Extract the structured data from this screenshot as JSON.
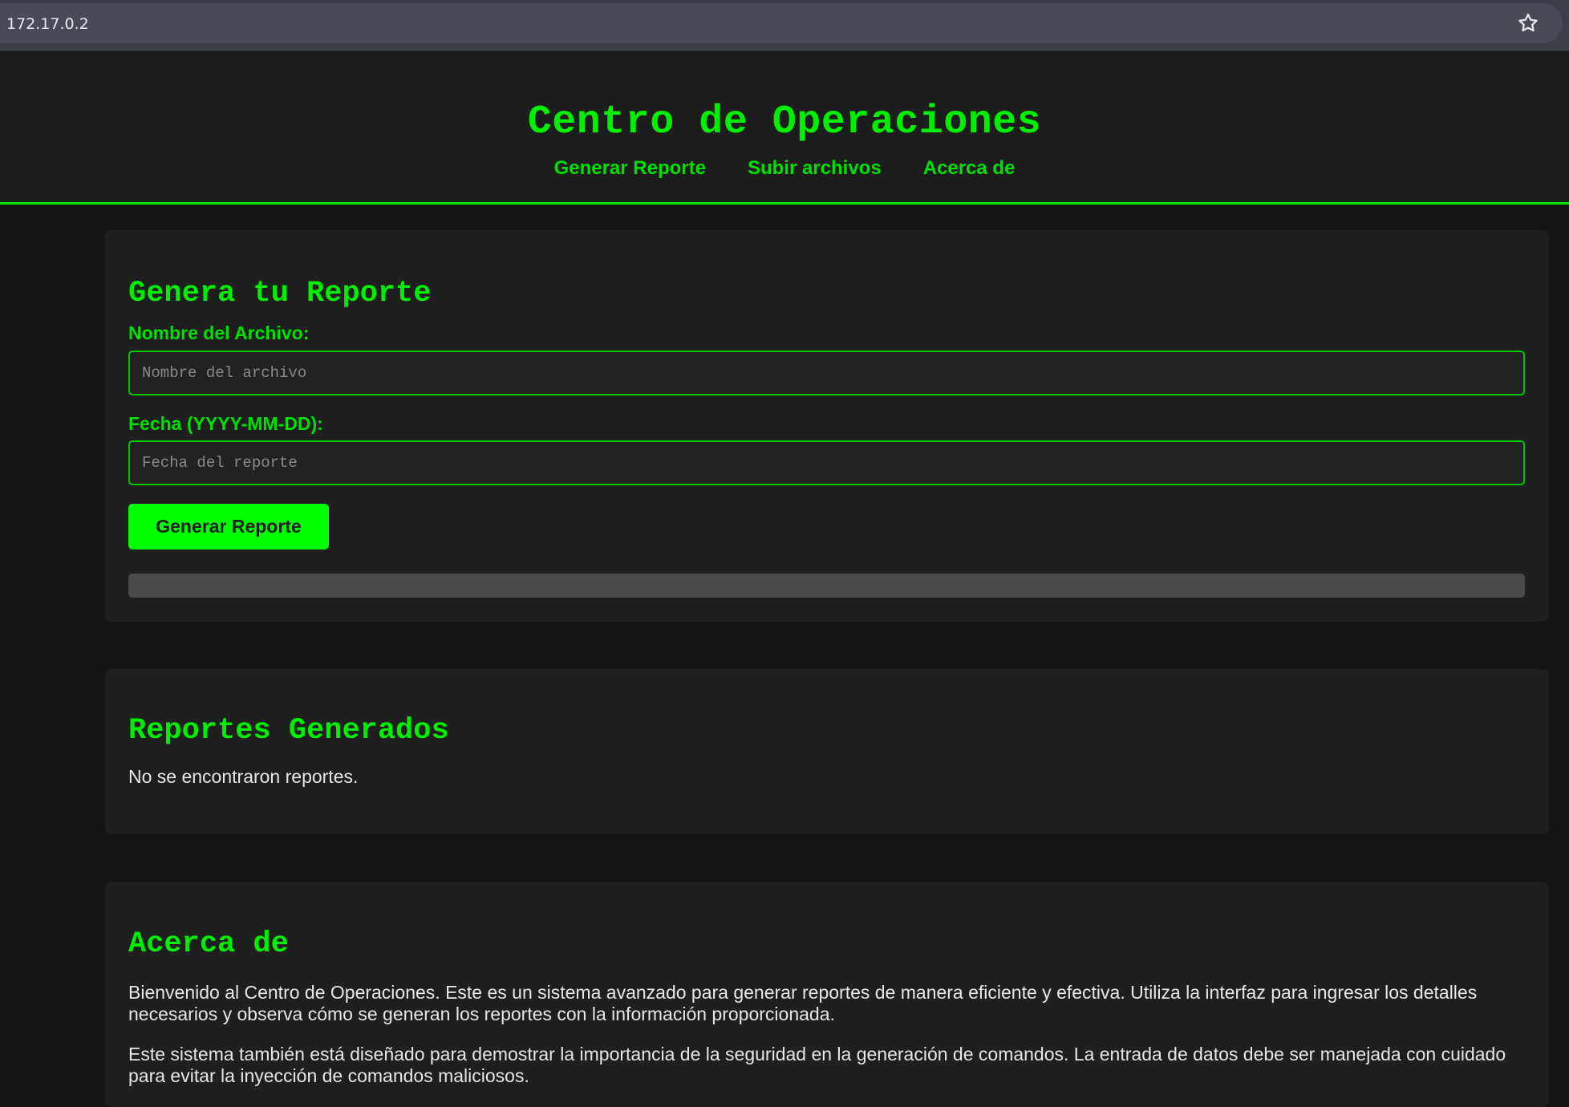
{
  "browser": {
    "url": "172.17.0.2",
    "bookmark_icon": "star-icon"
  },
  "header": {
    "title": "Centro de Operaciones",
    "nav": [
      {
        "label": "Generar Reporte"
      },
      {
        "label": "Subir archivos"
      },
      {
        "label": "Acerca de"
      }
    ]
  },
  "report_form": {
    "title": "Genera tu Reporte",
    "filename_label": "Nombre del Archivo:",
    "filename_placeholder": "Nombre del archivo",
    "filename_value": "",
    "date_label": "Fecha (YYYY-MM-DD):",
    "date_placeholder": "Fecha del reporte",
    "date_value": "",
    "submit_label": "Generar Reporte",
    "progress_percent": 0
  },
  "reports": {
    "title": "Reportes Generados",
    "empty_text": "No se encontraron reportes."
  },
  "about": {
    "title": "Acerca de",
    "paragraphs": [
      "Bienvenido al Centro de Operaciones. Este es un sistema avanzado para generar reportes de manera eficiente y efectiva. Utiliza la interfaz para ingresar los detalles necesarios y observa cómo se generan los reportes con la información proporcionada.",
      "Este sistema también está diseñado para demostrar la importancia de la seguridad en la generación de comandos. La entrada de datos debe ser manejada con cuidado para evitar la inyección de comandos maliciosos."
    ]
  },
  "colors": {
    "accent": "#00ff00",
    "page_bg": "#141414",
    "card_bg": "#1f1f1f"
  }
}
